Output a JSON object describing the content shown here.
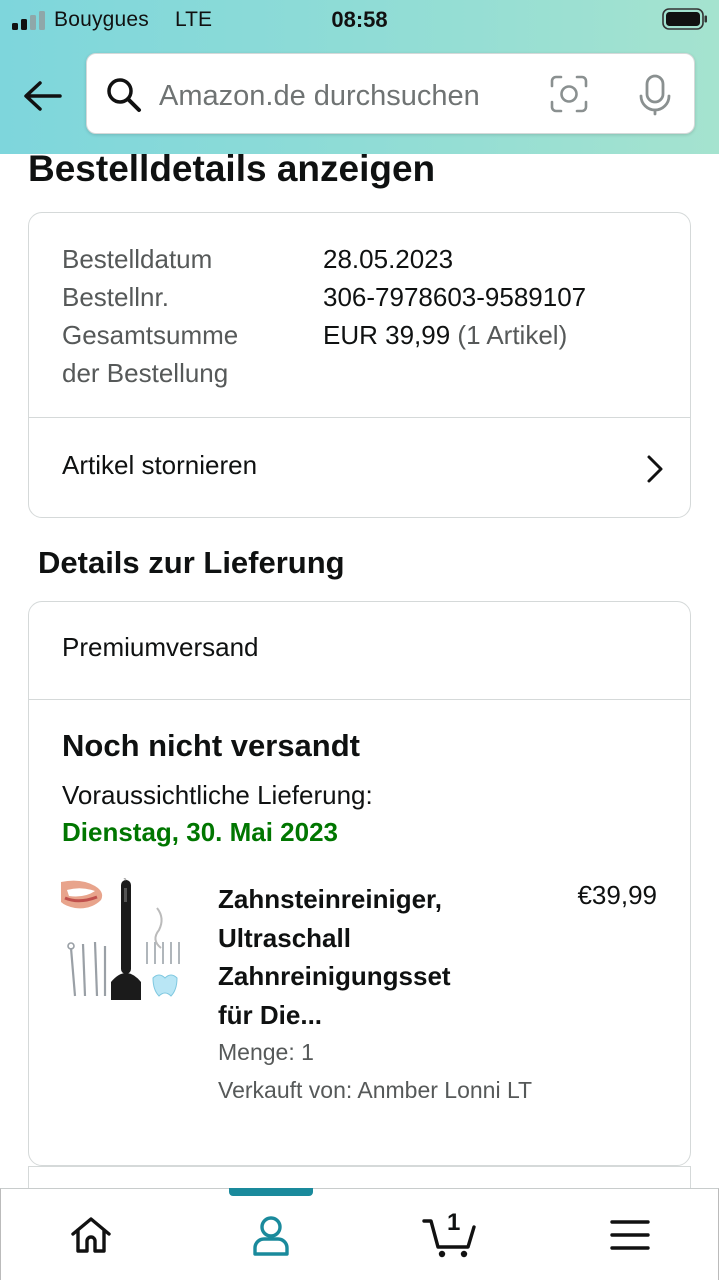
{
  "status_bar": {
    "carrier": "Bouygues",
    "network": "LTE",
    "time": "08:58",
    "signal_bars": 2,
    "battery_icon": "battery-icon"
  },
  "search": {
    "placeholder": "Amazon.de durchsuchen",
    "icons": [
      "back-arrow-icon",
      "search-icon",
      "camera-scan-icon",
      "microphone-icon"
    ]
  },
  "page": {
    "title": "Bestelldetails anzeigen"
  },
  "order_summary": {
    "date_label": "Bestelldatum",
    "date_value": "28.05.2023",
    "number_label": "Bestellnr.",
    "number_value": "306-7978603-9589107",
    "total_label_line1": "Gesamtsumme",
    "total_label_line2": "der Bestellung",
    "total_value": "EUR 39,99",
    "item_count": "(1 Artikel)",
    "cancel_label": "Artikel stornieren"
  },
  "delivery": {
    "section_title": "Details zur Lieferung",
    "shipping_method": "Premiumversand",
    "status": "Noch nicht versandt",
    "expected_label": "Voraussichtliche Lieferung:",
    "expected_date": "Dienstag, 30. Mai 2023",
    "item": {
      "title_line1": "Zahnsteinreiniger,",
      "title_line2": "Ultraschall",
      "title_line3": "Zahnreinigungsset",
      "title_line4": "für Die...",
      "price": "€39,99",
      "quantity": "Menge: 1",
      "seller": "Verkauft von: Anmber Lonni LT"
    }
  },
  "bottom_nav": {
    "items": [
      "home-icon",
      "account-icon",
      "cart-icon",
      "menu-icon"
    ],
    "active": "account",
    "cart_count": "1"
  },
  "colors": {
    "header_gradient_start": "#7ed6dc",
    "header_gradient_end": "#a5e3cf",
    "delivery_date": "#007600",
    "nav_active": "#1a8a9c"
  }
}
